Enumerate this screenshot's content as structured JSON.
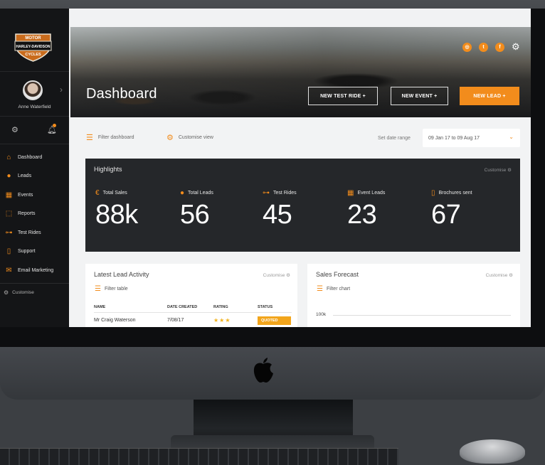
{
  "user": {
    "name": "Anne Waterfield"
  },
  "brand": {
    "logo_text_top": "MOTOR",
    "logo_text_mid": "HARLEY-DAVIDSON",
    "logo_text_bottom": "CYCLES"
  },
  "sidebar": {
    "items": [
      {
        "label": "Dashboard",
        "icon": "home-icon"
      },
      {
        "label": "Leads",
        "icon": "person-icon"
      },
      {
        "label": "Events",
        "icon": "calendar-icon"
      },
      {
        "label": "Reports",
        "icon": "chart-icon"
      },
      {
        "label": "Test Rides",
        "icon": "motorcycle-icon"
      },
      {
        "label": "Support",
        "icon": "book-icon"
      },
      {
        "label": "Email Marketing",
        "icon": "mail-icon"
      }
    ],
    "customise_label": "Customise"
  },
  "hero": {
    "title": "Dashboard",
    "buttons": {
      "new_test_ride": "NEW TEST RIDE +",
      "new_event": "NEW EVENT +",
      "new_lead": "NEW LEAD +"
    },
    "social": [
      "instagram-icon",
      "twitter-icon",
      "facebook-icon"
    ]
  },
  "toolbar": {
    "filter_label": "Filter dashboard",
    "customise_label": "Customise view",
    "date_range_label": "Set date range",
    "date_range_value": "09 Jan 17 to 09 Aug 17"
  },
  "highlights": {
    "title": "Highlights",
    "customise_label": "Customise",
    "stats": [
      {
        "label": "Total Sales",
        "value": "88k",
        "icon": "currency-icon"
      },
      {
        "label": "Total Leads",
        "value": "56",
        "icon": "person-icon"
      },
      {
        "label": "Test Rides",
        "value": "45",
        "icon": "motorcycle-icon"
      },
      {
        "label": "Event Leads",
        "value": "23",
        "icon": "calendar-icon"
      },
      {
        "label": "Brochures sent",
        "value": "67",
        "icon": "book-icon"
      }
    ]
  },
  "lead_activity": {
    "title": "Latest Lead Activity",
    "customise_label": "Customise",
    "filter_label": "Filter table",
    "columns": [
      "NAME",
      "DATE CREATED",
      "RATING",
      "STATUS"
    ],
    "rows": [
      {
        "name": "Mr Craig Waterson",
        "date": "7/08/17",
        "rating": 3,
        "stars": "★★★",
        "status": "QUOTED"
      }
    ]
  },
  "sales_forecast": {
    "title": "Sales Forecast",
    "customise_label": "Customise",
    "filter_label": "Filter chart",
    "y_tick": "100k"
  },
  "colors": {
    "accent": "#f28c1c",
    "sidebar_bg": "#141517",
    "highlights_bg": "#25272a"
  }
}
